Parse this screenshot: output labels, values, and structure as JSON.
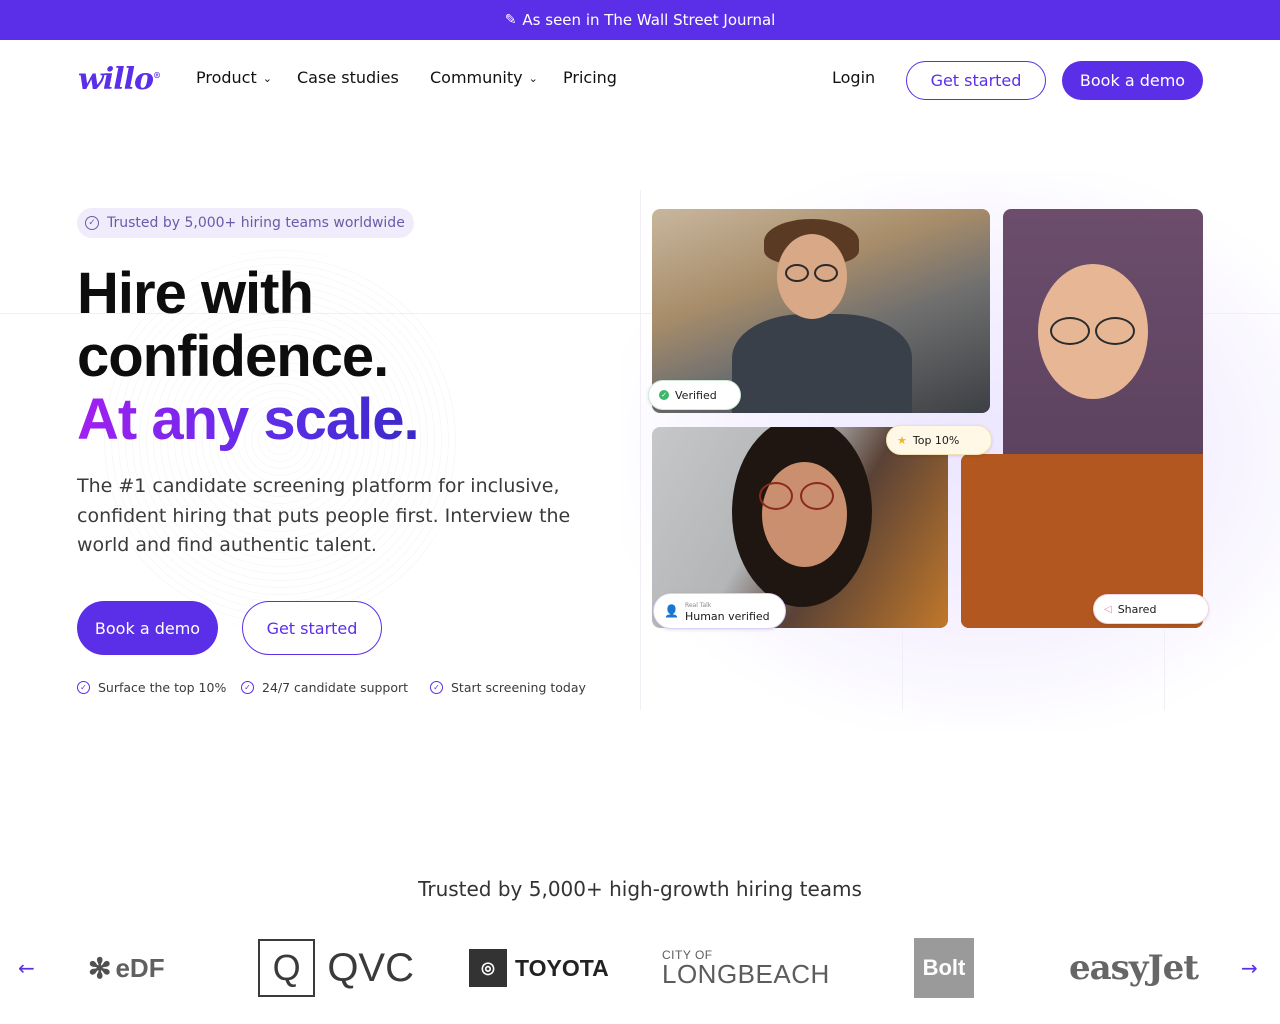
{
  "announcement": {
    "icon": "pencil-icon",
    "text": "As seen in The Wall Street Journal"
  },
  "header": {
    "logo": "willo",
    "nav": {
      "product": "Product",
      "case_studies": "Case studies",
      "community": "Community",
      "pricing": "Pricing"
    },
    "login": "Login",
    "get_started": "Get started",
    "book_demo": "Book a demo"
  },
  "hero": {
    "pill": "Trusted by 5,000+ hiring teams worldwide",
    "title_line1": "Hire with",
    "title_line2": "confidence.",
    "title_line3": "At any scale.",
    "subtext": "The #1 candidate screening platform for inclusive, confident hiring that puts people first. Interview the world and find authentic talent.",
    "cta_primary": "Book a demo",
    "cta_secondary": "Get started",
    "features": [
      "Surface the top 10%",
      "24/7 candidate support",
      "Start screening today"
    ]
  },
  "collage": {
    "badge_verified": "Verified",
    "badge_top": "Top 10%",
    "badge_human_small": "Real Talk",
    "badge_human": "Human verified",
    "badge_shared": "Shared"
  },
  "logos": {
    "heading": "Trusted by 5,000+ high-growth hiring teams",
    "edf": "eDF",
    "qvc_mark": "Q",
    "qvc": "QVC",
    "toyota": "TOYOTA",
    "longbeach_small": "CITY OF",
    "longbeach_big": "LONGBEACH",
    "bolt": "Bolt",
    "easyjet": "easyJet"
  },
  "colors": {
    "brand": "#5b2ee8",
    "gradient_start": "#a21ff0"
  }
}
